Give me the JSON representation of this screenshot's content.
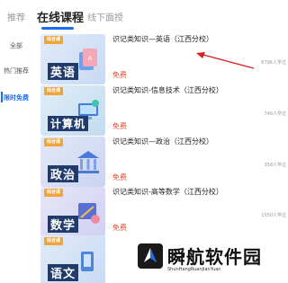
{
  "tabs": [
    {
      "label": "推荐"
    },
    {
      "label": "在线课程"
    },
    {
      "label": "线下面授"
    }
  ],
  "sidebar": {
    "items": [
      {
        "label": "全部"
      },
      {
        "label": "热门推荐"
      },
      {
        "label": "限时免费"
      }
    ]
  },
  "accent_color": "#1d6cf0",
  "price_color": "#e8472a",
  "courses": [
    {
      "tag": "综合课",
      "subject": "英语",
      "title": "识记类知识—英语（江西分校）",
      "price": "免费",
      "learners": "6796人学过",
      "theme_color": "#cfe0f6"
    },
    {
      "tag": "综合课",
      "subject": "计算机",
      "title": "识记类知识-信息技术（江西分校）",
      "price": "免费",
      "learners": "746人学过",
      "theme_color": "#cfe6f3"
    },
    {
      "tag": "综合课",
      "subject": "政治",
      "title": "识记类知识—政治（江西分校）",
      "price": "免费",
      "learners": "358人学过",
      "theme_color": "#d3dcf5"
    },
    {
      "tag": "综合课",
      "subject": "数学",
      "title": "识记类知识-高等数学（江西分校）",
      "price": "免费",
      "learners": "1550人学过",
      "theme_color": "#dcdcf6"
    },
    {
      "tag": "综合课",
      "subject": "语文",
      "title": "",
      "price": "",
      "learners": "",
      "theme_color": "#d6e4f6"
    }
  ],
  "watermark": {
    "name": "瞬航软件园",
    "url_text": "ShunHangRuanJianYuan"
  }
}
